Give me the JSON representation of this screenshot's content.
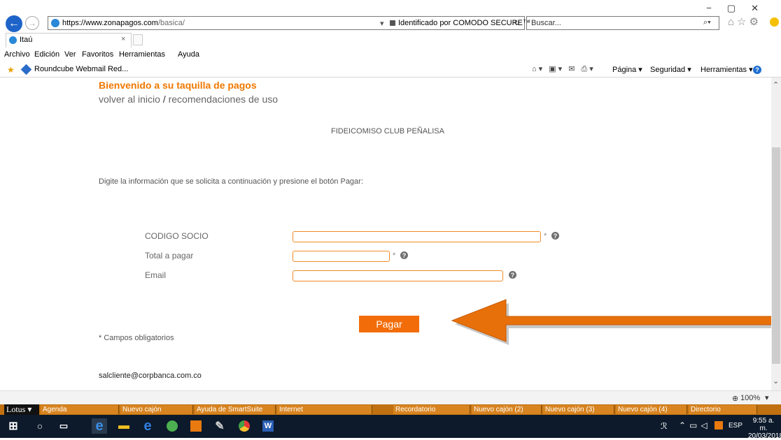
{
  "browser": {
    "url_host": "https://www.zonapagos.com",
    "url_path": "/basica/",
    "security_text": "Identificado por COMODO SECURE™",
    "search_placeholder": "Buscar...",
    "tab_title": "Itaú",
    "menu": [
      "Archivo",
      "Edición",
      "Ver",
      "Favoritos",
      "Herramientas",
      "Ayuda"
    ],
    "favorite": "Roundcube Webmail Red...",
    "cmd_pagina": "Página ▾",
    "cmd_seguridad": "Seguridad ▾",
    "cmd_herramientas": "Herramientas ▾",
    "zoom": "100%"
  },
  "page": {
    "welcome": "Bienvenido a su taquilla de pagos",
    "nav_home": "volver al inicio",
    "nav_sep": "/",
    "nav_reco": "recomendaciones de uso",
    "merchant": "FIDEICOMISO CLUB PEÑALISA",
    "instructions": "Digite la información que se solicita a continuación y presione el botón Pagar:",
    "fields": {
      "codigo_label": "CODIGO SOCIO",
      "total_label": "Total a pagar",
      "email_label": "Email",
      "required_mark": "*"
    },
    "pay_button": "Pagar",
    "required_note": "* Campos obligatorios",
    "contact_email": "salcliente@corpbanca.com.co"
  },
  "lotus": {
    "logo": "Lotus",
    "items": [
      "Agenda",
      "Nuevo cajón",
      "Ayuda de SmartSuite",
      "Internet",
      "Recordatorio",
      "Nuevo cajón (2)",
      "Nuevo cajón (3)",
      "Nuevo cajón (4)",
      "Directorio"
    ]
  },
  "taskbar": {
    "tray_lang": "ESP",
    "time": "9:55 a. m.",
    "date": "20/03/2018"
  },
  "colors": {
    "accent_orange": "#f26d0a",
    "arrow_orange": "#e8700a"
  }
}
